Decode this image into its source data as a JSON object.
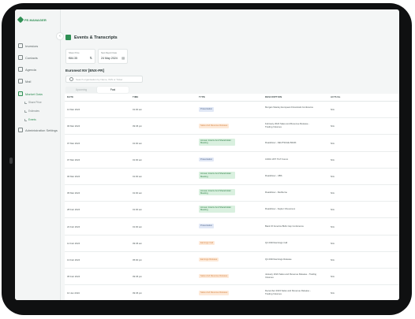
{
  "app": {
    "logo_text": "FE.MANAGER"
  },
  "sidebar": {
    "items": [
      {
        "label": "Investors",
        "icon": "user-icon"
      },
      {
        "label": "Contacts",
        "icon": "contacts-icon"
      },
      {
        "label": "Agenda",
        "icon": "calendar-icon"
      },
      {
        "label": "Mail",
        "icon": "mail-icon"
      },
      {
        "label": "Market Data",
        "icon": "chart-icon"
      },
      {
        "label": "Administration Settings",
        "icon": "settings-icon"
      }
    ],
    "sub_items": [
      {
        "label": "Share Price"
      },
      {
        "label": "Estimates"
      },
      {
        "label": "Events"
      }
    ]
  },
  "page": {
    "title": "Events & Transcripts",
    "company": "Euronext NV [ENX-FR]"
  },
  "cards": {
    "share_price": {
      "label": "Share Price",
      "value": "€84.35"
    },
    "next_report": {
      "label": "Next Report Date",
      "value": "24 May 2024"
    }
  },
  "search": {
    "placeholder": "Search organisation by Name, ISIN or Ticker"
  },
  "tabs": [
    {
      "label": "Upcoming"
    },
    {
      "label": "Past"
    }
  ],
  "table": {
    "headers": {
      "date": "DATE",
      "time": "TIME",
      "type": "TYPE",
      "description": "DESCRIPTION",
      "actual": "ACTUAL"
    },
    "rows": [
      {
        "date": "14 Mar 2024",
        "time": "01:00 am",
        "type": "Presentation",
        "type_style": "blue",
        "description": "Morgan Stanley European Financials Conference",
        "actual": "N/A"
      },
      {
        "date": "06 Mar 2024",
        "time": "09:45 pm",
        "type": "Sales And Revenue Release",
        "type_style": "orange",
        "description": "February 2024 Sales and Revenue Release - Trading Volumes",
        "actual": "N/A"
      },
      {
        "date": "07 Mar 2024",
        "time": "01:00 am",
        "type": "Annual, Interim And Shareholder Meeting",
        "type_style": "green",
        "description": "Roadshow - DEUTSCHE BANK",
        "actual": "N/A"
      },
      {
        "date": "07 Mar 2024",
        "time": "01:00 am",
        "type": "Presentation",
        "type_style": "blue",
        "description": "CODU WIT TGT Forum",
        "actual": "N/A"
      },
      {
        "date": "06 Mar 2024",
        "time": "01:00 am",
        "type": "Annual, Interim And Shareholder Meeting",
        "type_style": "green",
        "description": "Roadshow - UBS",
        "actual": "N/A"
      },
      {
        "date": "05 Mar 2024",
        "time": "01:00 am",
        "type": "Annual, Interim And Shareholder Meeting",
        "type_style": "green",
        "description": "Roadshow - Redburne",
        "actual": "N/A"
      },
      {
        "date": "28 Feb 2024",
        "time": "01:00 am",
        "type": "Annual, Interim And Shareholder Meeting",
        "type_style": "green",
        "description": "Roadshow - Kepler Cheuvreux",
        "actual": "N/A"
      },
      {
        "date": "22 Feb 2024",
        "time": "01:00 am",
        "type": "Presentation",
        "type_style": "blue",
        "description": "Bank Of America BHG Cap Conference",
        "actual": "N/A"
      },
      {
        "date": "14 Feb 2024",
        "time": "09:45 am",
        "type": "Earnings Call",
        "type_style": "orange",
        "description": "Q4 2023 Earnings Call",
        "actual": "N/A"
      },
      {
        "date": "13 Feb 2024",
        "time": "05:00 pm",
        "type": "Earnings Release",
        "type_style": "orange",
        "description": "Q4 2023 Earnings Release",
        "actual": "N/A"
      },
      {
        "date": "05 Feb 2024",
        "time": "09:45 pm",
        "type": "Sales And Revenue Release",
        "type_style": "orange",
        "description": "January 2024 Sales and Revenue Release - Trading Volumes",
        "actual": "N/A"
      },
      {
        "date": "10 Jan 2024",
        "time": "09:45 pm",
        "type": "Sales And Revenue Release",
        "type_style": "orange",
        "description": "December 2023 Sales and Revenue Release - Trading Volumes",
        "actual": "N/A"
      }
    ]
  },
  "colors": {
    "accent": "#2f8f54",
    "presentation": "#e1e8f6",
    "release": "#fde9d8",
    "meeting": "#d9f0df"
  }
}
